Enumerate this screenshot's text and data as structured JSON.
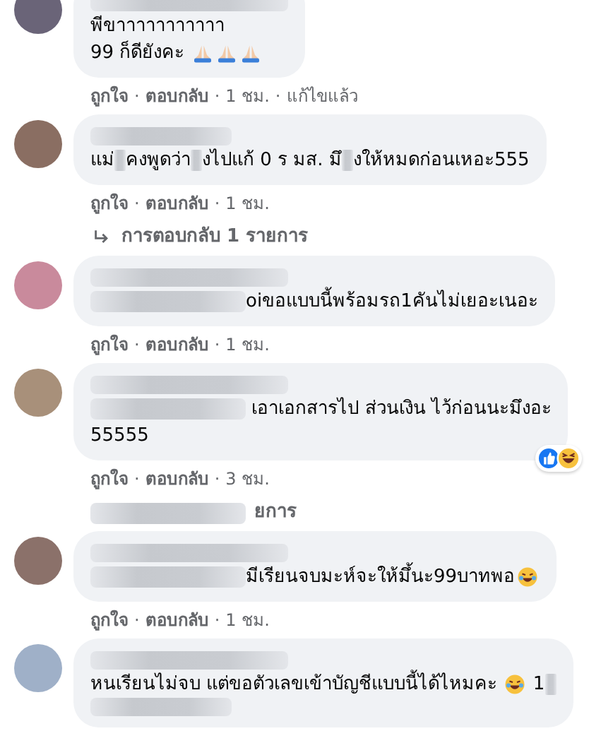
{
  "comments": [
    {
      "color": "#6a6478",
      "name": [
        {
          "kind": "wide"
        }
      ],
      "lines": [
        [
          {
            "kind": "text",
            "text": "พีขาาาาาาาาาาา"
          }
        ],
        [
          {
            "kind": "text",
            "text": "99 ก็ดียังคะ "
          },
          {
            "kind": "pray"
          },
          {
            "kind": "pray"
          },
          {
            "kind": "pray"
          }
        ]
      ],
      "meta": [
        "ถูกใจ",
        "·",
        "ตอบกลับ",
        "·",
        "1 ชม.",
        "·",
        "แก้ไขแล้ว"
      ]
    },
    {
      "color": "#8a6e62",
      "name": [
        {
          "kind": "short"
        }
      ],
      "lines": [
        [
          {
            "kind": "text",
            "text": "แม่"
          },
          {
            "kind": "small"
          },
          {
            "kind": "text",
            "text": "คงพูดว่า"
          },
          {
            "kind": "small"
          },
          {
            "kind": "text",
            "text": "งไปแก้ 0 ร มส. มึ"
          },
          {
            "kind": "small"
          },
          {
            "kind": "text",
            "text": "งให้หมดก่อนเหอะ555"
          }
        ]
      ],
      "meta": [
        "ถูกใจ",
        "·",
        "ตอบกลับ",
        "·",
        "1 ชม."
      ],
      "replies": [
        {
          "kind": "arrow"
        },
        {
          "kind": "text",
          "text": "การตอบกลับ 1 รายการ"
        }
      ]
    },
    {
      "color": "#c98a9c",
      "name": [
        {
          "kind": "wide"
        }
      ],
      "lines": [
        [
          {
            "kind": "lead"
          },
          {
            "kind": "text",
            "text": "oiขอแบบนี้พร้อมรถ1คันไม่เยอะเนอะ"
          }
        ]
      ],
      "meta": [
        "ถูกใจ",
        "·",
        "ตอบกลับ",
        "·",
        "1 ชม."
      ]
    },
    {
      "color": "#a8907a",
      "name": [
        {
          "kind": "wide"
        }
      ],
      "lines": [
        [
          {
            "kind": "lead"
          },
          {
            "kind": "text",
            "text": " เอาเอกสารไป ส่วนเงิน ไว้ก่อนนะมึงอะ"
          }
        ],
        [
          {
            "kind": "text",
            "text": "55555"
          }
        ]
      ],
      "reactions": [
        {
          "kind": "like"
        },
        {
          "kind": "haha"
        }
      ],
      "meta": [
        "ถูกใจ",
        "·",
        "ตอบกลับ",
        "·",
        "3 ชม."
      ],
      "replies": [
        {
          "kind": "lead"
        },
        {
          "kind": "text",
          "text": "ยการ"
        }
      ]
    },
    {
      "color": "#8b716a",
      "name": [
        {
          "kind": "wide"
        }
      ],
      "lines": [
        [
          {
            "kind": "lead"
          },
          {
            "kind": "text",
            "text": "มีเรียนจบมะห์จะให้มึ้นะ99บาทพอ"
          },
          {
            "kind": "laugh"
          }
        ]
      ],
      "meta": [
        "ถูกใจ",
        "·",
        "ตอบกลับ",
        "·",
        "1 ชม."
      ]
    },
    {
      "color": "#9fb0c8",
      "name": [
        {
          "kind": "wide"
        }
      ],
      "lines": [
        [
          {
            "kind": "text",
            "text": "หนเรียนไม่จบ แต่ขอตัวเลขเข้าบัญชีแบบนี้ได้ไหมคะ "
          },
          {
            "kind": "laugh"
          },
          {
            "kind": "text",
            "text": " 1"
          },
          {
            "kind": "small"
          }
        ],
        [
          {
            "kind": "short"
          }
        ]
      ]
    }
  ]
}
